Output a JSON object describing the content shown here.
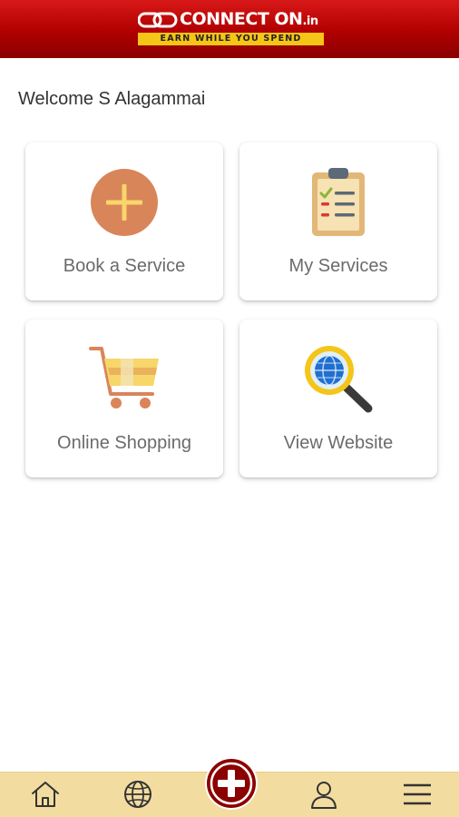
{
  "header": {
    "brand": "CONNECT ON",
    "brand_suffix": ".in",
    "tagline": "EARN WHILE YOU SPEND",
    "background_color": "#b00000"
  },
  "welcome_text": "Welcome S Alagammai",
  "cards": [
    {
      "label": "Book a Service",
      "icon": "plus-circle-icon"
    },
    {
      "label": "My Services",
      "icon": "clipboard-checklist-icon"
    },
    {
      "label": "Online Shopping",
      "icon": "shopping-cart-icon"
    },
    {
      "label": "View Website",
      "icon": "globe-magnifier-icon"
    }
  ],
  "bottom_nav": {
    "background_color": "#f2dca0",
    "items": [
      "home-icon",
      "globe-icon",
      "add-icon",
      "profile-icon",
      "menu-icon"
    ],
    "accent_color": "#8b0000"
  }
}
